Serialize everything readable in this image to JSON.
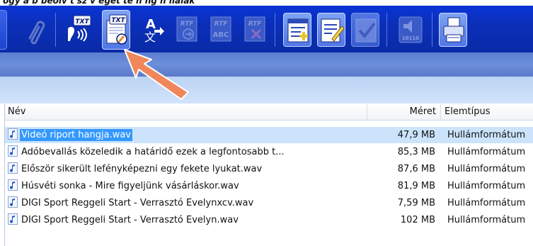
{
  "top_text": "ogy a b beolv t sz v eget te   h ng   h llalak",
  "toolbar": {
    "buttons": [
      {
        "icon": "partial-button-icon",
        "enabled": true
      },
      {
        "icon": "paperclip-icon",
        "enabled": false
      },
      {
        "icon": "txt-to-speech-icon",
        "label": "TXT",
        "enabled": true
      },
      {
        "icon": "txt-edit-icon",
        "label": "TXT",
        "enabled": true
      },
      {
        "icon": "text-translate-icon",
        "label": "A",
        "enabled": true
      },
      {
        "icon": "rtf-convert-icon",
        "label": "RTF",
        "enabled": false
      },
      {
        "icon": "rtf-abc-icon",
        "label": "RTF",
        "sub": "ABC",
        "enabled": false
      },
      {
        "icon": "rtf-delete-icon",
        "label": "RTF",
        "enabled": false
      },
      {
        "icon": "list-add-icon",
        "enabled": true
      },
      {
        "icon": "document-edit-icon",
        "enabled": true
      },
      {
        "icon": "checkmark-icon",
        "enabled": false
      },
      {
        "icon": "audio-binary-icon",
        "label": "10110",
        "enabled": false
      },
      {
        "icon": "printer-icon",
        "enabled": true
      }
    ]
  },
  "columns": {
    "name": "Név",
    "size": "Méret",
    "type": "Elemtípus"
  },
  "rows": [
    {
      "name": "Videó riport hangja.wav",
      "size": "47,9 MB",
      "type": "Hullámformátum",
      "selected": true
    },
    {
      "name": "Adóbevallás közeledik a határidő ezek a legfontosabb t...",
      "size": "85,3 MB",
      "type": "Hullámformátum",
      "selected": false
    },
    {
      "name": "Először sikerült lefényképezni egy fekete lyukat.wav",
      "size": "87,6 MB",
      "type": "Hullámformátum",
      "selected": false
    },
    {
      "name": "Húsvéti sonka - Mire figyeljünk vásárláskor.wav",
      "size": "81,9 MB",
      "type": "Hullámformátum",
      "selected": false
    },
    {
      "name": "DIGI Sport Reggeli Start - Verrasztó Evelynxcv.wav",
      "size": "7,59 MB",
      "type": "Hullámformátum",
      "selected": false
    },
    {
      "name": "DIGI Sport Reggeli Start - Verrasztó Evelyn.wav",
      "size": "102 MB",
      "type": "Hullámformátum",
      "selected": false
    }
  ],
  "colors": {
    "toolbar": "#0b2fb9",
    "selection": "#3399ff",
    "arrow": "#f0875a"
  }
}
